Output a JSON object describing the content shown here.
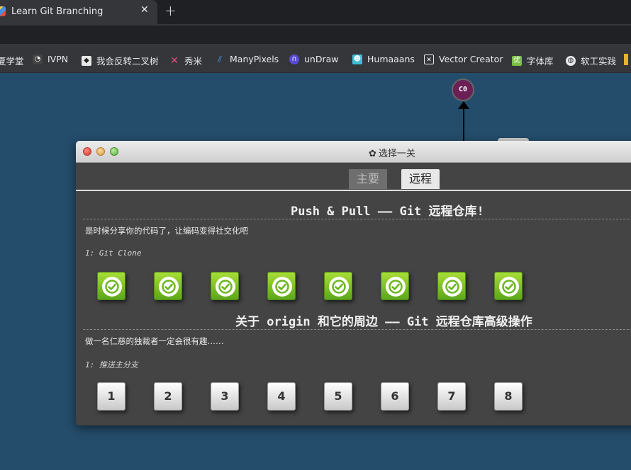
{
  "browser": {
    "tab_title": "Learn Git Branching",
    "close_glyph": "✕",
    "new_tab_glyph": "+"
  },
  "bookmarks": [
    {
      "label": "夏学堂",
      "icon": "partial-icon"
    },
    {
      "label": "IVPN",
      "icon": "ivpn-icon"
    },
    {
      "label": "我会反转二叉树",
      "icon": "tree-icon"
    },
    {
      "label": "秀米",
      "icon": "xiumi-icon"
    },
    {
      "label": "ManyPixels",
      "icon": "manypixels-icon"
    },
    {
      "label": "unDraw",
      "icon": "undraw-icon"
    },
    {
      "label": "Humaaans",
      "icon": "humaaans-icon"
    },
    {
      "label": "Vector Creator",
      "icon": "vector-creator-icon"
    },
    {
      "label": "字体库",
      "icon": "font-library-icon"
    },
    {
      "label": "软工实践",
      "icon": "globe-icon"
    }
  ],
  "graph": {
    "commit_label": "C0",
    "commit_color": "#6b1f55"
  },
  "dialog": {
    "title": "选择一关",
    "tabs": [
      {
        "label": "主要",
        "active": false
      },
      {
        "label": "远程",
        "active": true
      }
    ],
    "sections": [
      {
        "title": "Push & Pull —— Git 远程仓库!",
        "description": "是时候分享你的代码了，让编码变得社交化吧",
        "sequence_label": "1: Git Clone",
        "levels": [
          "done",
          "done",
          "done",
          "done",
          "done",
          "done",
          "done",
          "done"
        ]
      },
      {
        "title": "关于 origin 和它的周边 —— Git 远程仓库高级操作",
        "description": "做一名仁慈的独裁者一定会很有趣……",
        "sequence_label": "1: 推送主分支",
        "levels": [
          "1",
          "2",
          "3",
          "4",
          "5",
          "6",
          "7",
          "8"
        ]
      }
    ]
  },
  "colors": {
    "background": "#244d6b",
    "done_green": "#6bb620",
    "dialog_body": "#444444"
  }
}
